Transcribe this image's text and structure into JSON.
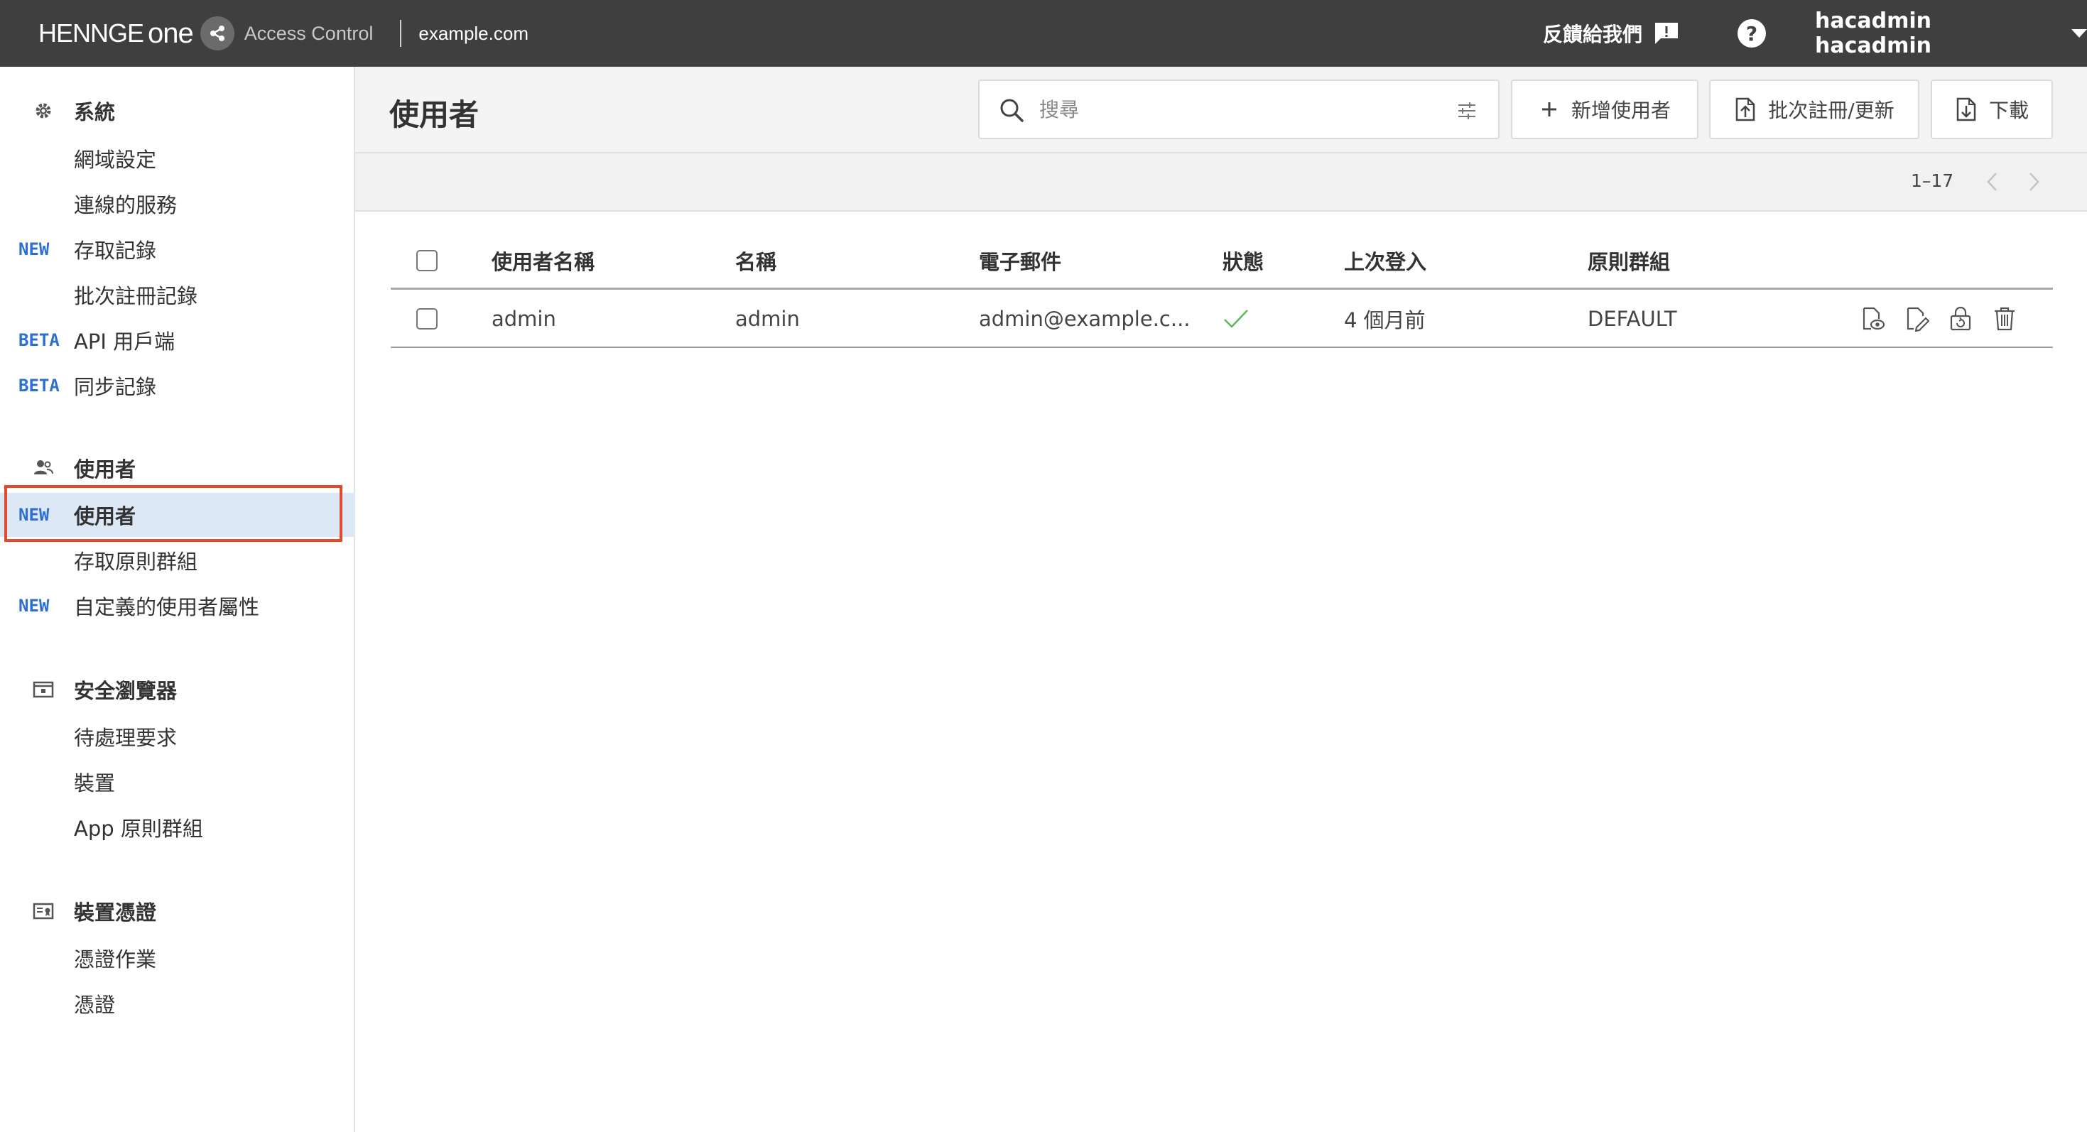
{
  "header": {
    "brand_name": "HENNGE",
    "brand_suffix": "one",
    "product": "Access Control",
    "domain": "example.com",
    "feedback": "反饋給我們",
    "help": "?",
    "account": "hacadmin hacadmin"
  },
  "sidebar": {
    "sections": [
      {
        "title": "系統",
        "icon": "gear-icon",
        "items": [
          {
            "label": "網域設定",
            "badge": ""
          },
          {
            "label": "連線的服務",
            "badge": ""
          },
          {
            "label": "存取記錄",
            "badge": "NEW"
          },
          {
            "label": "批次註冊記錄",
            "badge": ""
          },
          {
            "label": "API 用戶端",
            "badge": "BETA"
          },
          {
            "label": "同步記錄",
            "badge": "BETA"
          }
        ]
      },
      {
        "title": "使用者",
        "icon": "users-icon",
        "items": [
          {
            "label": "使用者",
            "badge": "NEW",
            "active": true
          },
          {
            "label": "存取原則群組",
            "badge": ""
          },
          {
            "label": "自定義的使用者屬性",
            "badge": "NEW"
          }
        ]
      },
      {
        "title": "安全瀏覽器",
        "icon": "secure-browser-icon",
        "items": [
          {
            "label": "待處理要求",
            "badge": ""
          },
          {
            "label": "裝置",
            "badge": ""
          },
          {
            "label": "App 原則群組",
            "badge": ""
          }
        ]
      },
      {
        "title": "裝置憑證",
        "icon": "certificate-icon",
        "items": [
          {
            "label": "憑證作業",
            "badge": ""
          },
          {
            "label": "憑證",
            "badge": ""
          }
        ]
      }
    ]
  },
  "main": {
    "title": "使用者",
    "search": {
      "placeholder": "搜尋"
    },
    "buttons": {
      "add": "新增使用者",
      "bulk": "批次註冊/更新",
      "download": "下載"
    },
    "pager": {
      "range": "1–17"
    },
    "table": {
      "columns": [
        "使用者名稱",
        "名稱",
        "電子郵件",
        "狀態",
        "上次登入",
        "原則群組"
      ],
      "rows": [
        {
          "username": "admin",
          "name": "admin",
          "email": "admin@example.c...",
          "status": "active",
          "last_login": "4 個月前",
          "policy_group": "DEFAULT"
        }
      ]
    }
  },
  "colors": {
    "topbar": "#3f3f3f",
    "accent_badge": "#2f6fd0",
    "active_bg": "#dde8f7",
    "highlight_outline": "#e04b2f",
    "status_ok": "#5cb85c"
  }
}
